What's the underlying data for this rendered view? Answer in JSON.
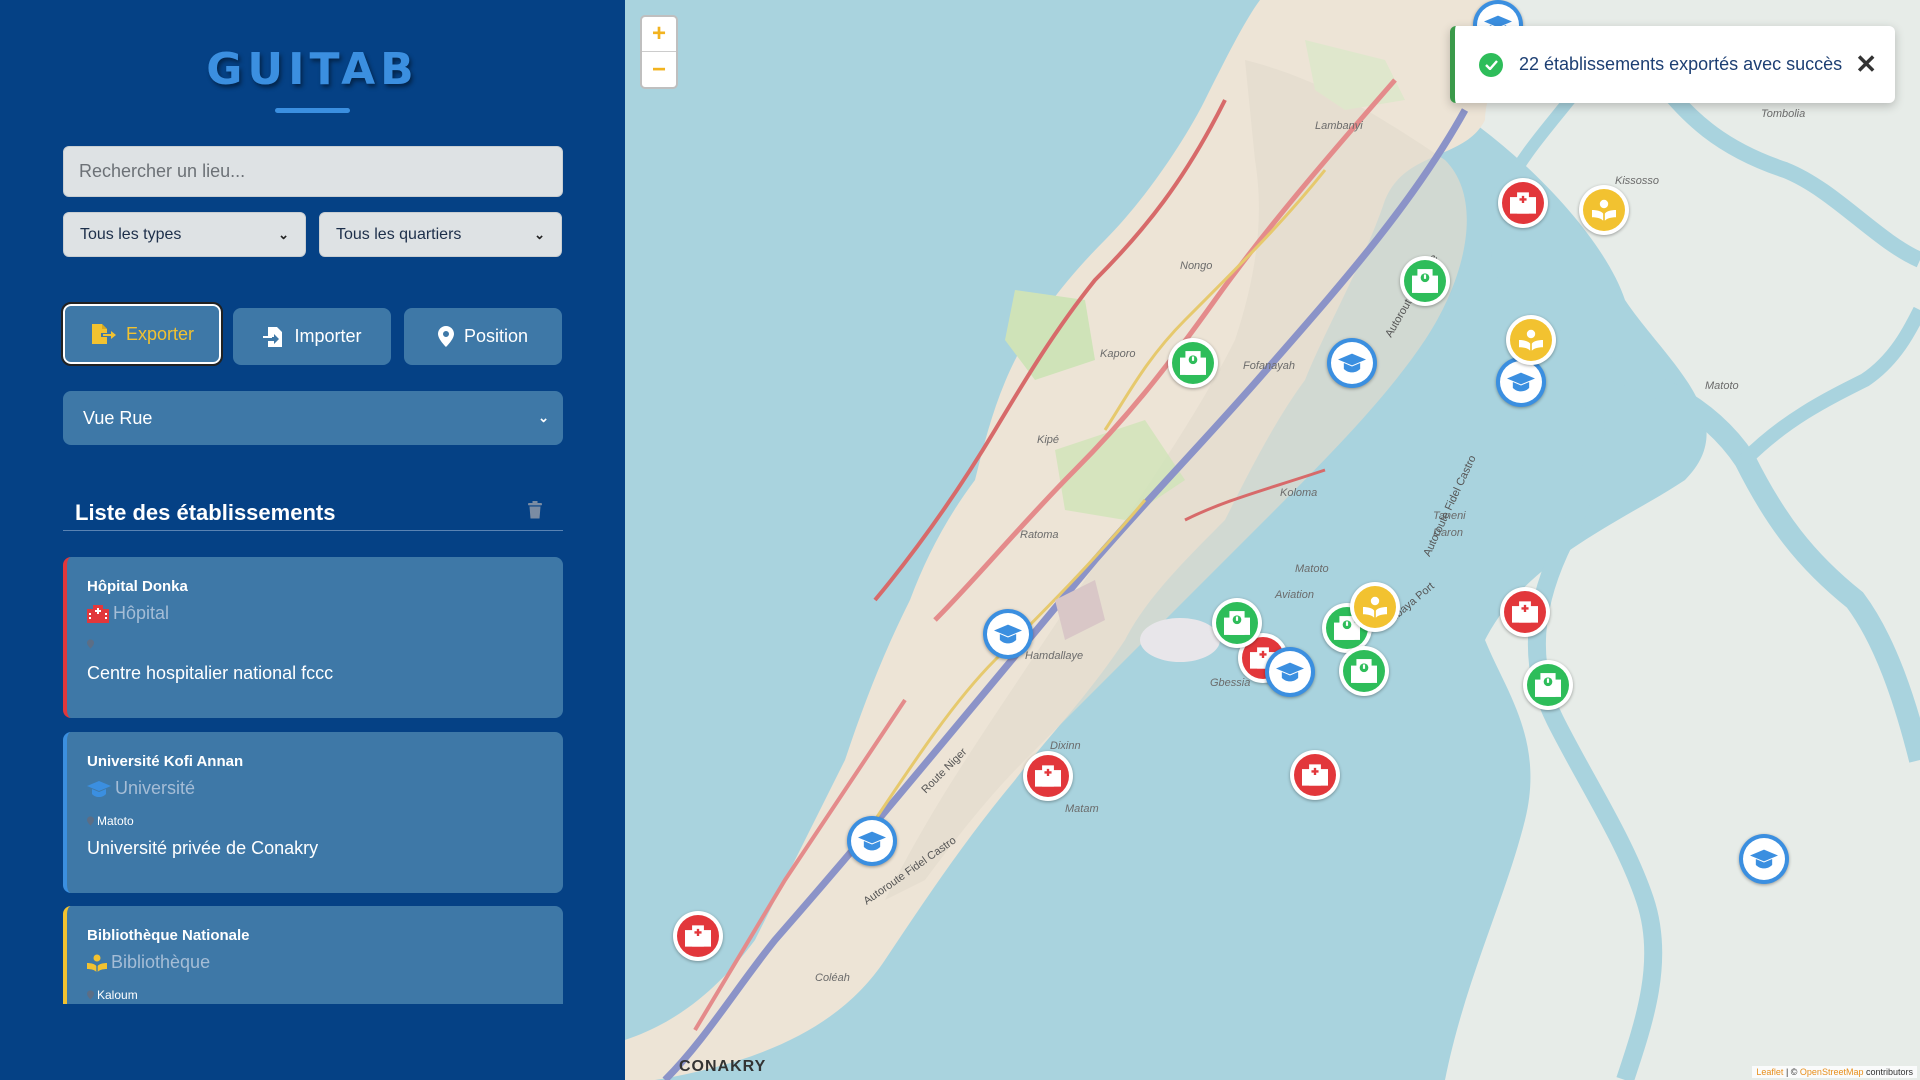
{
  "brand": {
    "title": "GUITAB"
  },
  "search": {
    "placeholder": "Rechercher un lieu..."
  },
  "filters": {
    "type_selected": "Tous les types",
    "quarter_selected": "Tous les quartiers"
  },
  "actions": {
    "export_label": "Exporter",
    "import_label": "Importer",
    "position_label": "Position"
  },
  "view": {
    "selected": "Vue Rue"
  },
  "list": {
    "title": "Liste des établissements",
    "items": [
      {
        "name": "Hôpital Donka",
        "type": "Hôpital",
        "quarter": "",
        "description": "Centre hospitalier national fccc"
      },
      {
        "name": "Université Kofi Annan",
        "type": "Université",
        "quarter": "Matoto",
        "description": "Université privée de Conakry"
      },
      {
        "name": "Bibliothèque Nationale",
        "type": "Bibliothèque",
        "quarter": "Kaloum",
        "description": ""
      }
    ]
  },
  "map": {
    "zoom_in": "+",
    "zoom_out": "−",
    "city_label": "CONAKRY",
    "attribution": {
      "leaflet": "Leaflet",
      "sep": " | © ",
      "osm": "OpenStreetMap",
      "contributors": " contributors"
    },
    "places": [
      "Lambanyi",
      "Tombolia",
      "Kissosso",
      "Nongo",
      "Kaporo",
      "Fofanayah",
      "Kipé",
      "Koloma",
      "Ratoma",
      "Taneni",
      "Daron",
      "Aviation",
      "Matoto",
      "Gbessia",
      "Hamdallaye",
      "Dixinn",
      "Matam",
      "Coléah",
      "Matoto"
    ],
    "roads": [
      "Autoroute le Prince",
      "Autoroute Fidel Castro",
      "Route Niger",
      "Yimbaya Port",
      "Autoroute Fidel Castro"
    ]
  },
  "toast": {
    "message": "22 établissements exportés avec succès",
    "close": "✕"
  },
  "colors": {
    "sidebar_bg": "#054185",
    "accent_blue": "#3b8fe0",
    "hopital": "#e2373b",
    "universite": "#3b8fe0",
    "centre_sante": "#2ebd5a",
    "bibliotheque": "#f2c230",
    "button_bg": "#3e78a7"
  }
}
